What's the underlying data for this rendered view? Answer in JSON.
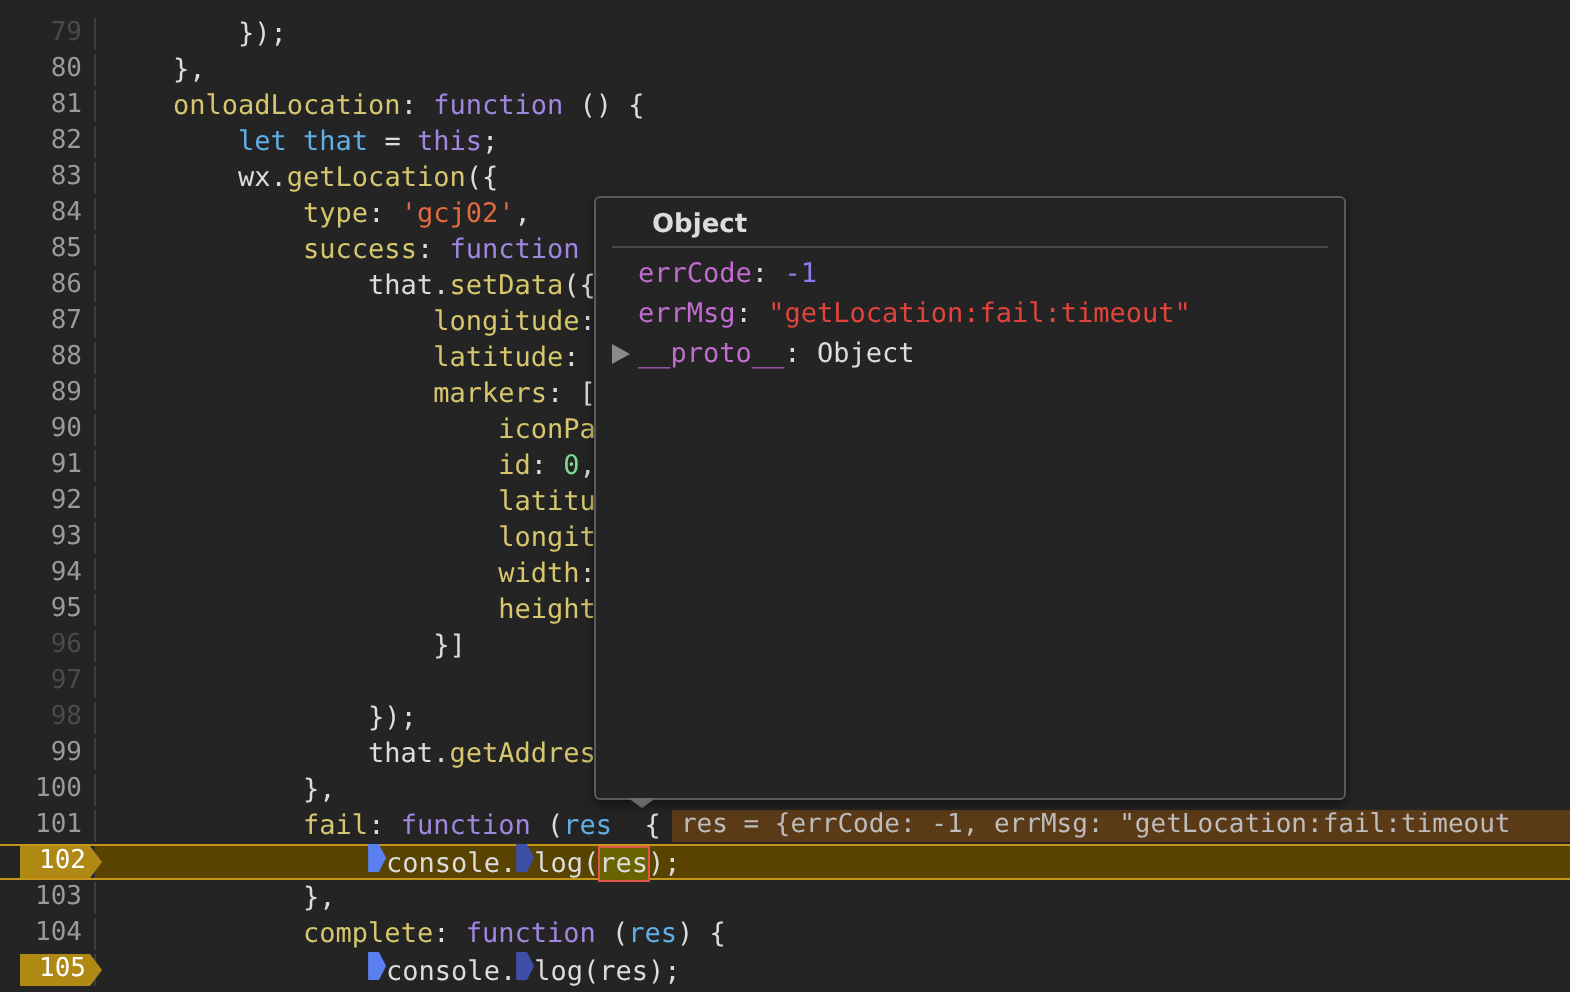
{
  "editor": {
    "lines": [
      {
        "number": "79",
        "executable": false,
        "breakpoint": false,
        "current": false,
        "tokens": [
          {
            "kind": "plain",
            "text": "        });"
          }
        ]
      },
      {
        "number": "80",
        "executable": true,
        "breakpoint": false,
        "current": false,
        "tokens": [
          {
            "kind": "plain",
            "text": "    },"
          }
        ]
      },
      {
        "number": "81",
        "executable": true,
        "breakpoint": false,
        "current": false,
        "tokens": [
          {
            "kind": "prop",
            "text": "    onloadLocation"
          },
          {
            "kind": "plain",
            "text": ": "
          },
          {
            "kind": "keyword",
            "text": "function"
          },
          {
            "kind": "plain",
            "text": " () {"
          }
        ]
      },
      {
        "number": "82",
        "executable": true,
        "breakpoint": false,
        "current": false,
        "tokens": [
          {
            "kind": "decl",
            "text": "        let that"
          },
          {
            "kind": "plain",
            "text": " = "
          },
          {
            "kind": "keyword",
            "text": "this"
          },
          {
            "kind": "plain",
            "text": ";"
          }
        ]
      },
      {
        "number": "83",
        "executable": true,
        "breakpoint": false,
        "current": false,
        "tokens": [
          {
            "kind": "plain",
            "text": "        wx."
          },
          {
            "kind": "prop",
            "text": "getLocation"
          },
          {
            "kind": "plain",
            "text": "({"
          }
        ]
      },
      {
        "number": "84",
        "executable": true,
        "breakpoint": false,
        "current": false,
        "tokens": [
          {
            "kind": "prop",
            "text": "            type"
          },
          {
            "kind": "plain",
            "text": ": "
          },
          {
            "kind": "string",
            "text": "'gcj02'"
          },
          {
            "kind": "plain",
            "text": ","
          }
        ]
      },
      {
        "number": "85",
        "executable": true,
        "breakpoint": false,
        "current": false,
        "tokens": [
          {
            "kind": "prop",
            "text": "            success"
          },
          {
            "kind": "plain",
            "text": ": "
          },
          {
            "kind": "keyword",
            "text": "function"
          }
        ]
      },
      {
        "number": "86",
        "executable": true,
        "breakpoint": false,
        "current": false,
        "tokens": [
          {
            "kind": "plain",
            "text": "                that."
          },
          {
            "kind": "prop",
            "text": "setData"
          },
          {
            "kind": "plain",
            "text": "({"
          }
        ]
      },
      {
        "number": "87",
        "executable": true,
        "breakpoint": false,
        "current": false,
        "tokens": [
          {
            "kind": "prop",
            "text": "                    longitude"
          },
          {
            "kind": "plain",
            "text": ":"
          }
        ]
      },
      {
        "number": "88",
        "executable": true,
        "breakpoint": false,
        "current": false,
        "tokens": [
          {
            "kind": "prop",
            "text": "                    latitude"
          },
          {
            "kind": "plain",
            "text": ":"
          }
        ]
      },
      {
        "number": "89",
        "executable": true,
        "breakpoint": false,
        "current": false,
        "tokens": [
          {
            "kind": "prop",
            "text": "                    markers"
          },
          {
            "kind": "plain",
            "text": ": ["
          }
        ]
      },
      {
        "number": "90",
        "executable": true,
        "breakpoint": false,
        "current": false,
        "tokens": [
          {
            "kind": "prop",
            "text": "                        iconPa"
          }
        ]
      },
      {
        "number": "91",
        "executable": true,
        "breakpoint": false,
        "current": false,
        "tokens": [
          {
            "kind": "prop",
            "text": "                        id"
          },
          {
            "kind": "plain",
            "text": ": "
          },
          {
            "kind": "number",
            "text": "0"
          },
          {
            "kind": "plain",
            "text": ","
          }
        ]
      },
      {
        "number": "92",
        "executable": true,
        "breakpoint": false,
        "current": false,
        "tokens": [
          {
            "kind": "prop",
            "text": "                        latitu"
          }
        ]
      },
      {
        "number": "93",
        "executable": true,
        "breakpoint": false,
        "current": false,
        "tokens": [
          {
            "kind": "prop",
            "text": "                        longit"
          }
        ]
      },
      {
        "number": "94",
        "executable": true,
        "breakpoint": false,
        "current": false,
        "tokens": [
          {
            "kind": "prop",
            "text": "                        width"
          },
          {
            "kind": "plain",
            "text": ":"
          }
        ]
      },
      {
        "number": "95",
        "executable": true,
        "breakpoint": false,
        "current": false,
        "tokens": [
          {
            "kind": "prop",
            "text": "                        height"
          }
        ]
      },
      {
        "number": "96",
        "executable": false,
        "breakpoint": false,
        "current": false,
        "tokens": [
          {
            "kind": "plain",
            "text": "                    }]"
          }
        ]
      },
      {
        "number": "97",
        "executable": false,
        "breakpoint": false,
        "current": false
      },
      {
        "number": "98",
        "executable": false,
        "breakpoint": false,
        "current": false,
        "tokens": [
          {
            "kind": "plain",
            "text": "                });"
          }
        ]
      },
      {
        "number": "99",
        "executable": true,
        "breakpoint": false,
        "current": false,
        "tokens": [
          {
            "kind": "plain",
            "text": "                that."
          },
          {
            "kind": "prop",
            "text": "getAddres"
          }
        ]
      },
      {
        "number": "100",
        "executable": true,
        "breakpoint": false,
        "current": false,
        "tokens": [
          {
            "kind": "plain",
            "text": "            },"
          }
        ]
      },
      {
        "number": "101",
        "executable": true,
        "breakpoint": false,
        "current": false,
        "tokens": [
          {
            "kind": "prop",
            "text": "            fail"
          },
          {
            "kind": "plain",
            "text": ": "
          },
          {
            "kind": "keyword",
            "text": "function"
          },
          {
            "kind": "plain",
            "text": " ("
          },
          {
            "kind": "param",
            "text": "res"
          },
          {
            "kind": "plain",
            "text": "  {"
          }
        ],
        "inline_value": "res = {errCode: -1, errMsg: \"getLocation:fail:timeout"
      },
      {
        "number": "102",
        "executable": true,
        "breakpoint": true,
        "current": true,
        "tokens": [
          {
            "kind": "plain",
            "text": "                console.",
            "marker_active": true
          },
          {
            "kind": "plain",
            "text": "log(",
            "marker_active": false
          },
          {
            "kind": "hover",
            "text": "res"
          },
          {
            "kind": "plain",
            "text": ");"
          }
        ]
      },
      {
        "number": "103",
        "executable": true,
        "breakpoint": false,
        "current": false,
        "tokens": [
          {
            "kind": "plain",
            "text": "            },"
          }
        ]
      },
      {
        "number": "104",
        "executable": true,
        "breakpoint": false,
        "current": false,
        "tokens": [
          {
            "kind": "prop",
            "text": "            complete"
          },
          {
            "kind": "plain",
            "text": ": "
          },
          {
            "kind": "keyword",
            "text": "function"
          },
          {
            "kind": "plain",
            "text": " ("
          },
          {
            "kind": "param",
            "text": "res"
          },
          {
            "kind": "plain",
            "text": ") {"
          }
        ]
      },
      {
        "number": "105",
        "executable": true,
        "breakpoint": true,
        "current": false,
        "tokens": [
          {
            "kind": "plain",
            "text": "                console.",
            "marker_active": true
          },
          {
            "kind": "plain",
            "text": "log(res);",
            "marker_active": false
          }
        ]
      }
    ]
  },
  "popover": {
    "title": "Object",
    "properties": [
      {
        "name": "errCode",
        "separator": ":",
        "kind": "number",
        "value": "-1",
        "expandable": false
      },
      {
        "name": "errMsg",
        "separator": ":",
        "kind": "string",
        "value": "\"getLocation:fail:timeout\"",
        "expandable": false
      },
      {
        "name": "__proto__",
        "separator": ":",
        "kind": "object",
        "value": "Object",
        "expandable": true
      }
    ]
  }
}
